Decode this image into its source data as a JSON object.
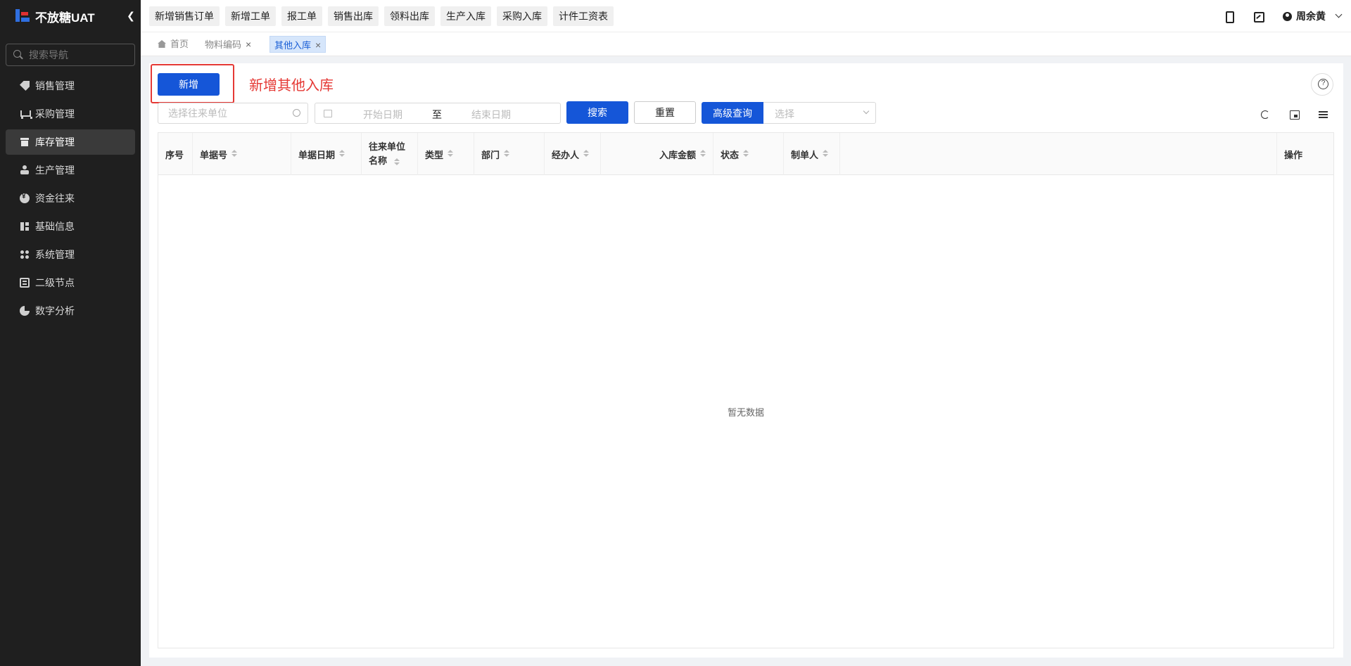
{
  "app": {
    "brand": "不放糖UAT",
    "search_placeholder": "搜索导航"
  },
  "sidebar": {
    "items": [
      {
        "label": "销售管理",
        "icon": "tag-icon"
      },
      {
        "label": "采购管理",
        "icon": "cart-icon"
      },
      {
        "label": "库存管理",
        "icon": "inventory-icon",
        "active": true
      },
      {
        "label": "生产管理",
        "icon": "production-icon"
      },
      {
        "label": "资金往来",
        "icon": "money-icon"
      },
      {
        "label": "基础信息",
        "icon": "base-info-icon"
      },
      {
        "label": "系统管理",
        "icon": "system-icon"
      },
      {
        "label": "二级节点",
        "icon": "node-icon"
      },
      {
        "label": "数字分析",
        "icon": "pie-chart-icon"
      }
    ]
  },
  "topbar": {
    "quick_links": [
      "新增销售订单",
      "新增工单",
      "报工单",
      "销售出库",
      "领料出库",
      "生产入库",
      "采购入库",
      "计件工资表"
    ],
    "user_name": "周余黄"
  },
  "tabs": [
    {
      "label": "首页",
      "closable": false
    },
    {
      "label": "物料编码",
      "closable": true
    },
    {
      "label": "其他入库",
      "closable": true,
      "active": true
    }
  ],
  "toolbar": {
    "add_label": "新增",
    "annotation": "新增其他入库",
    "partner_placeholder": "选择往来单位",
    "start_date_placeholder": "开始日期",
    "range_separator": "至",
    "end_date_placeholder": "结束日期",
    "search_label": "搜索",
    "reset_label": "重置",
    "advanced_label": "高级查询",
    "advanced_placeholder": "选择"
  },
  "table": {
    "columns": [
      "序号",
      "单据号",
      "单据日期",
      "往来单位名称",
      "类型",
      "部门",
      "经办人",
      "入库金额",
      "状态",
      "制单人",
      "",
      "操作"
    ],
    "empty_text": "暂无数据"
  },
  "colors": {
    "primary": "#1556d8",
    "sidebar_bg": "#1f1f1f",
    "annotation": "#e53935"
  }
}
